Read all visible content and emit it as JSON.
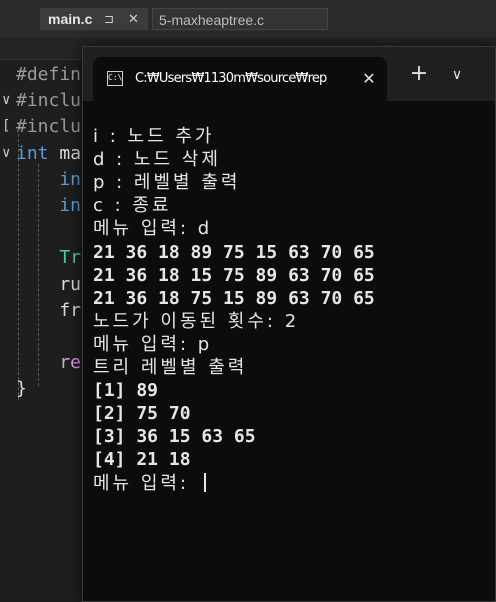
{
  "editor": {
    "tabs": [
      {
        "label": "main.c",
        "pin": "⊐",
        "close": "✕"
      },
      {
        "label": "5-maxheaptree.c"
      }
    ],
    "side_hint": "…",
    "code_lines": [
      {
        "fold": "",
        "parts": [
          {
            "t": "#defin",
            "c": "pre"
          }
        ]
      },
      {
        "fold": "∨",
        "parts": [
          {
            "t": "#inclu",
            "c": "pre"
          }
        ]
      },
      {
        "fold": "[",
        "parts": [
          {
            "t": "#inclu",
            "c": "pre"
          }
        ]
      },
      {
        "fold": "∨",
        "parts": [
          {
            "t": "int ",
            "c": "kw"
          },
          {
            "t": "ma",
            "c": "fn"
          }
        ]
      },
      {
        "fold": "",
        "parts": [
          {
            "t": "    in",
            "c": "kw"
          }
        ]
      },
      {
        "fold": "",
        "parts": [
          {
            "t": "    in",
            "c": "kw"
          }
        ]
      },
      {
        "fold": "",
        "parts": [
          {
            "t": "",
            "c": "fn"
          }
        ]
      },
      {
        "fold": "",
        "parts": [
          {
            "t": "    Tr",
            "c": "ty"
          }
        ]
      },
      {
        "fold": "",
        "parts": [
          {
            "t": "    ru",
            "c": "fn"
          }
        ]
      },
      {
        "fold": "",
        "parts": [
          {
            "t": "    fr",
            "c": "fn"
          }
        ]
      },
      {
        "fold": "",
        "parts": [
          {
            "t": "",
            "c": "fn"
          }
        ]
      },
      {
        "fold": "",
        "parts": [
          {
            "t": "    re",
            "c": "ctl"
          }
        ]
      },
      {
        "fold": "",
        "parts": [
          {
            "t": "}",
            "c": "fn"
          }
        ]
      }
    ]
  },
  "terminal": {
    "icon_text": "C:\\",
    "tab_title": "C:₩Users₩1130m₩source₩rep",
    "tab_close": "✕",
    "new_tab": "+",
    "dropdown": "∨",
    "lines": [
      {
        "text": "i : 노드 추가",
        "kr": true
      },
      {
        "text": "d : 노드 삭제",
        "kr": true
      },
      {
        "text": "p : 레벨별 출력",
        "kr": true
      },
      {
        "text": "c : 종료",
        "kr": true
      },
      {
        "text": "메뉴 입력: d",
        "kr": true
      },
      {
        "text": "21 36 18 89 75 15 63 70 65",
        "kr": false
      },
      {
        "text": "21 36 18 15 75 89 63 70 65",
        "kr": false
      },
      {
        "text": "21 36 18 75 15 89 63 70 65",
        "kr": false
      },
      {
        "text": "노드가 이동된 횟수: 2",
        "kr": true
      },
      {
        "text": "메뉴 입력: p",
        "kr": true
      },
      {
        "text": "트리 레벨별 출력",
        "kr": true
      },
      {
        "text": "[1] 89",
        "kr": false
      },
      {
        "text": "[2] 75 70",
        "kr": false
      },
      {
        "text": "[3] 36 15 63 65",
        "kr": false
      },
      {
        "text": "[4] 21 18",
        "kr": false
      },
      {
        "text": "메뉴 입력: ",
        "kr": true,
        "cursor": true
      }
    ]
  }
}
